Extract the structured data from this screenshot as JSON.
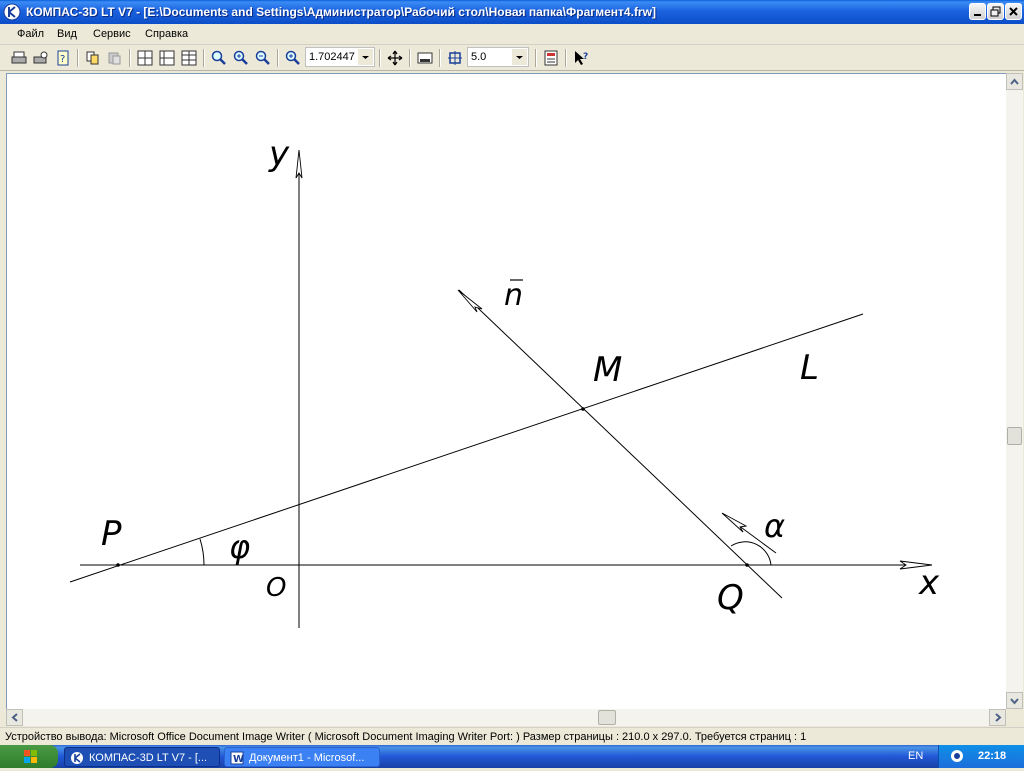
{
  "window": {
    "title": "КОМПАС-3D LT V7 - [E:\\Documents and Settings\\Администратор\\Рабочий стол\\Новая папка\\Фрагмент4.frw]"
  },
  "menu": {
    "items": [
      "Файл",
      "Вид",
      "Сервис",
      "Справка"
    ]
  },
  "toolbar": {
    "zoom_value": "1.702447",
    "step_value": "5.0"
  },
  "drawing": {
    "labels": {
      "y_axis": "y",
      "x_axis": "x",
      "origin": "O",
      "point_p": "P",
      "point_m": "M",
      "point_q": "Q",
      "line_l": "L",
      "normal_n": "n",
      "angle_phi": "φ",
      "angle_alpha": "α"
    }
  },
  "statusbar": {
    "text": "Устройство вывода: Microsoft Office Document Image Writer ( Microsoft Document Imaging Writer Port: )  Размер страницы : 210.0 x 297.0.  Требуется страниц : 1"
  },
  "taskbar": {
    "tasks": [
      "КОМПАС-3D LT V7 - [...",
      "Документ1 - Microsof..."
    ],
    "lang": "EN",
    "clock": "22:18"
  },
  "colors": {
    "titlebar": "#0c4ec8",
    "taskbar": "#2157d7",
    "canvas": "#ffffff"
  }
}
